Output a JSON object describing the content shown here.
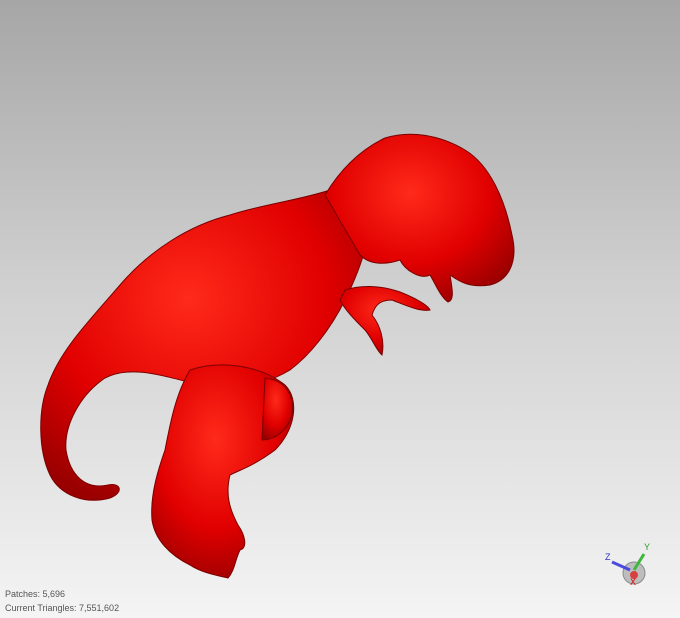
{
  "viewport": {
    "model_color": "#e00000",
    "background_top": "#a6a6a6",
    "background_bottom": "#f4f4f4"
  },
  "status": {
    "patches": "Patches: 5,696",
    "triangles": "Current Triangles: 7,551,602"
  },
  "axis_gizmo": {
    "x_label": "X",
    "y_label": "Y",
    "z_label": "Z"
  }
}
